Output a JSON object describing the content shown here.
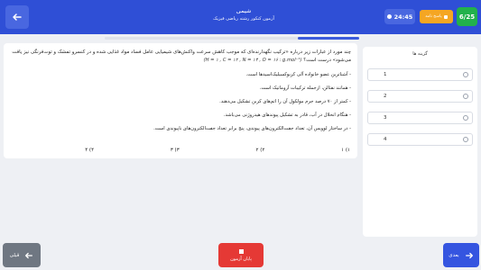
{
  "header": {
    "title": "شیمی",
    "subtitle": "آزمون کنکور رشته ریاضی فیزیک",
    "timer": "24:45",
    "answers_label": "پاسخ نامه",
    "counter": "6/25"
  },
  "progress": {
    "fraction": 0.24
  },
  "question": {
    "stem": "چند مورد از عبارات زیر درباره «ترکیب نگهدارنده‌ای که موجب کاهش سرعت واکنش‌های شیمیایی عامل فساد مواد غذایی شده و در کنسرو تمشک و توت‌فرنگی نیز یافت می‌شود» درست است؟",
    "formula": "(H = ۱ , C = ۱۲ , N = ۱۴ , O = ۱۶ : g.mol⁻¹)",
    "statements": [
      "- آشناترین عضو خانواده آلی کربوکسیلیک‌اسیدها است.",
      "- همانند نفتالن، ازجمله ترکیبات آروماتیک است.",
      "- کمتر از ۷۰ درصد جرم مولکول آن را اتم‌های کربن تشکیل می‌دهند.",
      "- هنگام انحلال در آب، قادر به تشکیل پیوندهای هیدروژنی می‌باشد.",
      "- در ساختار لوویس آن، تعداد جفت‌الکترون‌های پیوندی، پنج برابر تعداد جفت‌الکترون‌های ناپیوندی است."
    ],
    "options": [
      "۱) ۱",
      "۲) ۲",
      "۳) ۳",
      "۴) ۴"
    ]
  },
  "answer_panel": {
    "title": "گزینه ها",
    "options": [
      "1",
      "2",
      "3",
      "4"
    ]
  },
  "footer": {
    "prev_label": "قبلی",
    "end_label": "پایان آزمون",
    "next_label": "بعدی"
  },
  "colors": {
    "header": "#2f4fd6",
    "timer": "#4967e0",
    "answers_badge": "#f5a623",
    "counter": "#22b14c",
    "end_button": "#e53935",
    "next_button": "#3555e0",
    "prev_button": "#6f7782"
  }
}
